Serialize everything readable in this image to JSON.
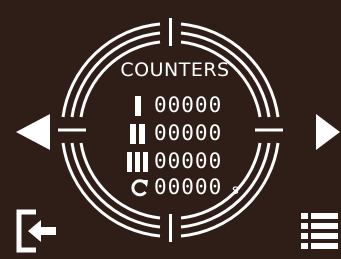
{
  "title": "COUNTERS",
  "counters": [
    {
      "icon": "counter-1-icon",
      "value": "00000"
    },
    {
      "icon": "counter-2-icon",
      "value": "00000"
    },
    {
      "icon": "counter-3-icon",
      "value": "00000"
    },
    {
      "icon": "cycle-icon",
      "value": "00000",
      "unit": "s"
    }
  ],
  "nav": {
    "prev": "arrow-left-icon",
    "next": "arrow-right-icon",
    "exit": "exit-icon",
    "menu": "list-menu-icon"
  },
  "colors": {
    "background": "#2f1e17",
    "foreground": "#ffffff"
  }
}
